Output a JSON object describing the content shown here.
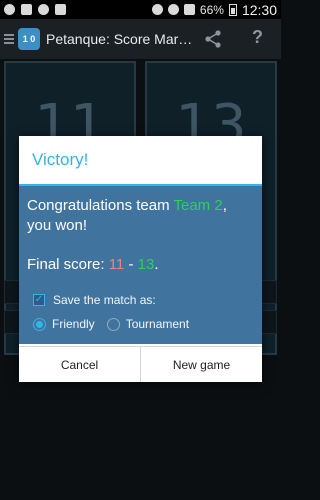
{
  "status_bar": {
    "battery": "66%",
    "time": "12:30"
  },
  "app": {
    "icon_text": "1 0",
    "title": "Petanque: Score Mar…"
  },
  "background": {
    "left_score": "11",
    "right_score": "13"
  },
  "dialog": {
    "title": "Victory!",
    "congrats_prefix": "Congratulations team ",
    "winning_team": "Team 2",
    "congrats_suffix": ",",
    "congrats_line2": "you won!",
    "final_prefix": "Final score: ",
    "score_left": "11",
    "score_sep": " - ",
    "score_right": "13",
    "final_suffix": ".",
    "save_label": "Save the match as:",
    "save_checked": true,
    "options": [
      "Friendly",
      "Tournament"
    ],
    "selected_option": "Friendly",
    "cancel_label": "Cancel",
    "new_game_label": "New game"
  },
  "colors": {
    "accent": "#33b5e5",
    "dialog_body": "#40749e",
    "winner": "#2ccf5a",
    "loser": "#f08080"
  }
}
